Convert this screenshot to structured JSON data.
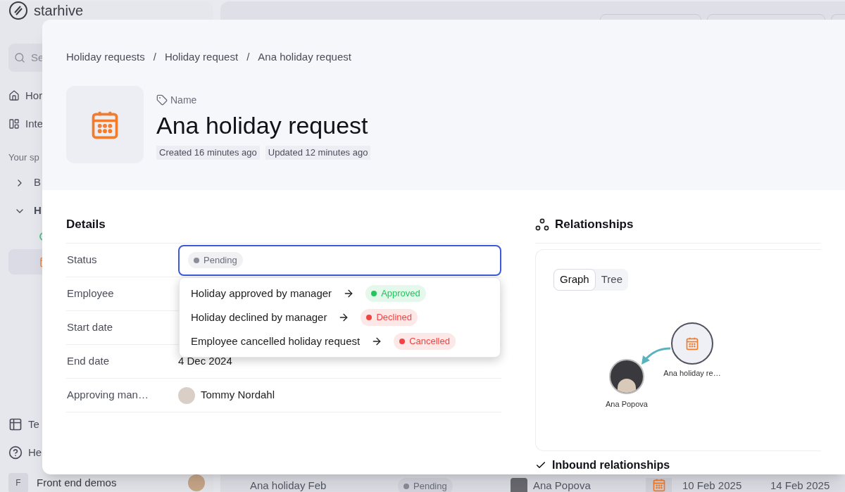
{
  "sidebar": {
    "logo": "starhive",
    "search_placeholder": "Se",
    "items": [
      {
        "label": "Hor",
        "kind": "home"
      },
      {
        "label": "Inte",
        "kind": "layout"
      }
    ],
    "section_title": "Your sp",
    "tree": [
      {
        "label": "B",
        "expanded": false
      },
      {
        "label": "H",
        "expanded": true,
        "children": [
          {
            "kind": "status",
            "selected": false
          },
          {
            "kind": "calendar",
            "selected": true
          }
        ]
      }
    ],
    "bottom_items": [
      {
        "label": "Te",
        "kind": "table"
      },
      {
        "label": "He",
        "kind": "help"
      }
    ],
    "workspace": {
      "initial": "F",
      "name": "Front end demos"
    }
  },
  "background_row": {
    "name": "Ana holiday Feb",
    "status": "Pending",
    "employee": "Ana Popova",
    "start_date": "10 Feb 2025",
    "end_date": "14 Feb 2025"
  },
  "modal": {
    "breadcrumb_separator": "/",
    "breadcrumbs": [
      "Holiday requests",
      "Holiday request",
      "Ana holiday request"
    ],
    "name_label": "Name",
    "title": "Ana holiday request",
    "meta": [
      "Created 16 minutes ago",
      "Updated 12 minutes ago"
    ],
    "details": {
      "title": "Details",
      "fields": [
        {
          "label": "Status",
          "kind": "status",
          "value": "Pending",
          "color": "#8b8e99"
        },
        {
          "label": "Employee",
          "kind": "text"
        },
        {
          "label": "Start date",
          "kind": "text"
        },
        {
          "label": "End date",
          "kind": "text",
          "value": "4 Dec 2024"
        },
        {
          "label": "Approving man…",
          "kind": "person",
          "value": "Tommy Nordahl"
        }
      ]
    },
    "dropdown": {
      "options": [
        {
          "label": "Holiday approved by manager",
          "target": "Approved",
          "color": "#22c55e"
        },
        {
          "label": "Holiday declined by manager",
          "target": "Declined",
          "color": "#ef4444"
        },
        {
          "label": "Employee cancelled holiday request",
          "target": "Cancelled",
          "color": "#ef4444"
        }
      ]
    },
    "relationships": {
      "title": "Relationships",
      "tabs": [
        {
          "label": "Graph",
          "selected": true
        },
        {
          "label": "Tree",
          "selected": false
        }
      ],
      "nodes": [
        {
          "label": "Ana holiday re…",
          "kind": "record"
        },
        {
          "label": "Ana Popova",
          "kind": "person"
        }
      ],
      "inbound_title": "Inbound relationships"
    }
  }
}
